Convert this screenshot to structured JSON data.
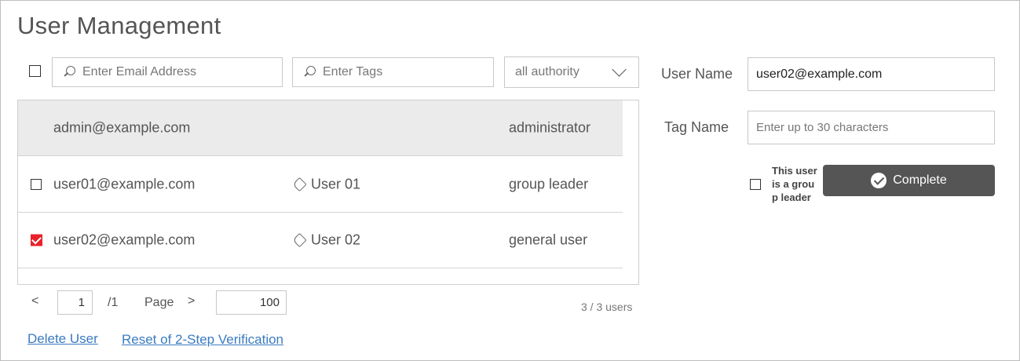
{
  "title": "User Management",
  "filters": {
    "email_placeholder": "Enter Email Address",
    "tags_placeholder": "Enter Tags",
    "authority_selected": "all authority"
  },
  "table": {
    "rows": [
      {
        "email": "admin@example.com",
        "tag": "",
        "role": "administrator",
        "checked": false,
        "has_checkbox": false
      },
      {
        "email": "user01@example.com",
        "tag": "User 01",
        "role": "group leader",
        "checked": false,
        "has_checkbox": true
      },
      {
        "email": "user02@example.com",
        "tag": "User 02",
        "role": "general user",
        "checked": true,
        "has_checkbox": true
      }
    ]
  },
  "pagination": {
    "prev": "<",
    "current_page": "1",
    "total_pages": "/1",
    "page_label": "Page",
    "next": ">",
    "per_page": "100",
    "count": "3 / 3 users"
  },
  "actions": {
    "delete_user": "Delete User",
    "reset_2step": "Reset of 2-Step Verification"
  },
  "form": {
    "user_name_label": "User Name",
    "user_name_value": "user02@example.com",
    "tag_name_label": "Tag Name",
    "tag_name_placeholder": "Enter up to 30 characters",
    "group_leader_line1": "This user",
    "group_leader_line2": "is a grou",
    "group_leader_line3": "p leader",
    "complete_label": "Complete"
  },
  "colors": {
    "checked_red": "#e8212b",
    "link_blue": "#3a7bbf",
    "button_dark": "#555555",
    "admin_row_bg": "#ebebeb"
  }
}
